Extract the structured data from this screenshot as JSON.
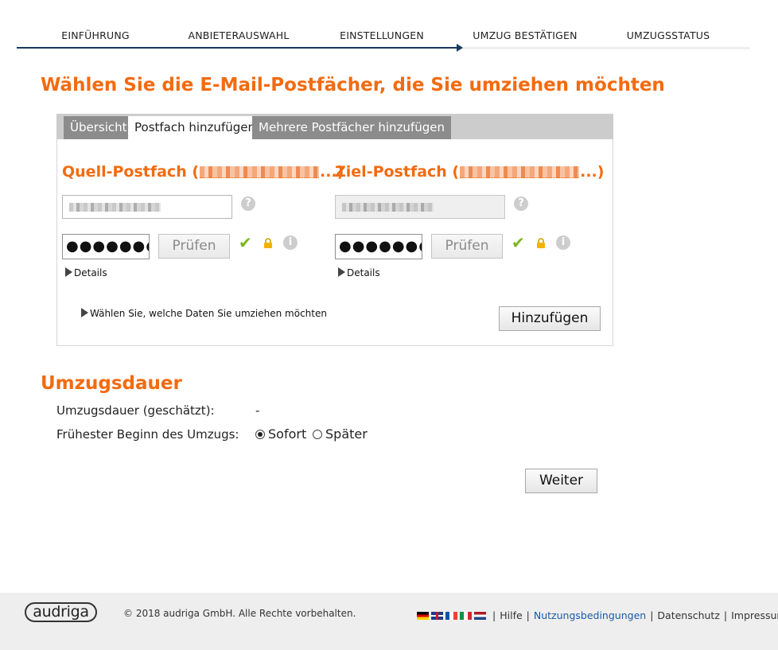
{
  "wizard": {
    "steps": [
      "EINFÜHRUNG",
      "ANBIETERAUSWAHL",
      "EINSTELLUNGEN",
      "UMZUG BESTÄTIGEN",
      "UMZUGSSTATUS"
    ]
  },
  "page_title": "Wählen Sie die E-Mail-Postfächer, die Sie umziehen möchten",
  "tabs": [
    "Übersicht",
    "Postfach hinzufügen",
    "Mehrere Postfächer hinzufügen"
  ],
  "active_tab": "Postfach hinzufügen",
  "source": {
    "title_prefix": "Quell-Postfach (",
    "title_suffix": "...)",
    "password_mask": "●●●●●●●●●",
    "check_label": "Prüfen",
    "details_label": "Details"
  },
  "target": {
    "title_prefix": "Ziel-Postfach (",
    "title_suffix": "...)",
    "password_mask": "●●●●●●●●●",
    "check_label": "Prüfen",
    "details_label": "Details"
  },
  "data_select_label": "Wählen Sie, welche Daten Sie umziehen möchten",
  "add_button": "Hinzufügen",
  "duration": {
    "section_title": "Umzugsdauer",
    "estimated_label": "Umzugsdauer (geschätzt):",
    "estimated_value": "-",
    "start_label": "Frühester Beginn des Umzugs:",
    "options": [
      "Sofort",
      "Später"
    ],
    "selected": "Sofort"
  },
  "next_button": "Weiter",
  "footer": {
    "logo": "audriga",
    "copyright": "© 2018 audriga GmbH. Alle Rechte vorbehalten.",
    "languages": [
      "de",
      "gb",
      "fr",
      "it",
      "nl"
    ],
    "links": [
      "Hilfe",
      "Nutzungsbedingungen",
      "Datenschutz",
      "Impressum"
    ]
  },
  "colors": {
    "accent": "#f26b10",
    "progress": "#1b3a5c",
    "link": "#1a5aa8",
    "valid": "#7ab51d"
  }
}
